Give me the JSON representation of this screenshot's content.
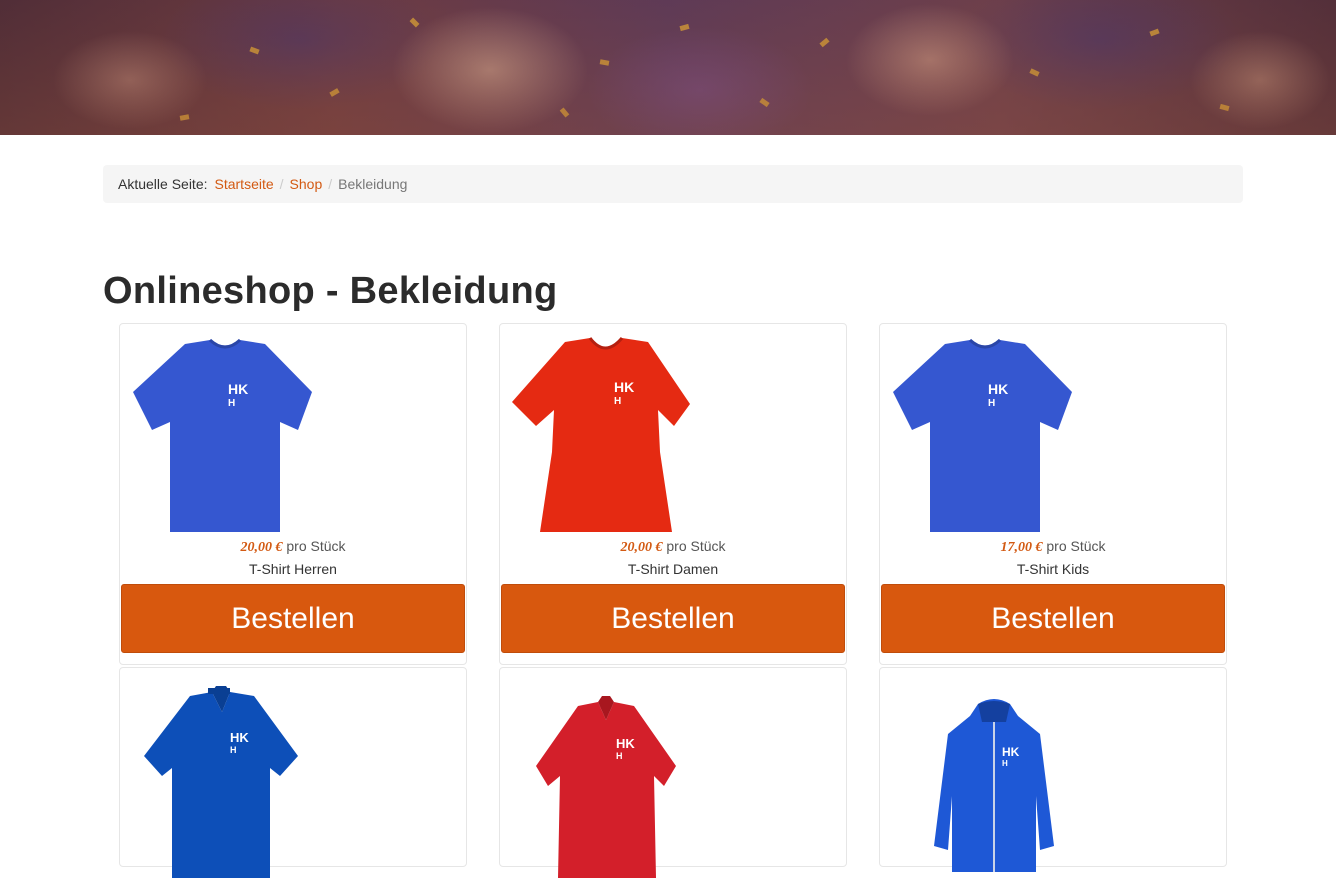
{
  "breadcrumb": {
    "label": "Aktuelle Seite:",
    "items": [
      "Startseite",
      "Shop"
    ],
    "current": "Bekleidung"
  },
  "page_title": "Onlineshop - Bekleidung",
  "colors": {
    "accent": "#d8580e",
    "link": "#d35a13",
    "shirt_blue": "#3557d0",
    "shirt_red": "#e52a12"
  },
  "products": [
    {
      "price": "20,00 €",
      "unit": "pro Stück",
      "name": "T-Shirt Herren",
      "button": "Bestellen",
      "image": "blue-tshirt"
    },
    {
      "price": "20,00 €",
      "unit": "pro Stück",
      "name": "T-Shirt Damen",
      "button": "Bestellen",
      "image": "red-tshirt-women"
    },
    {
      "price": "17,00 €",
      "unit": "pro Stück",
      "name": "T-Shirt Kids",
      "button": "Bestellen",
      "image": "blue-tshirt"
    },
    {
      "image": "blue-polo"
    },
    {
      "image": "red-polo-women"
    },
    {
      "image": "blue-jacket"
    }
  ]
}
